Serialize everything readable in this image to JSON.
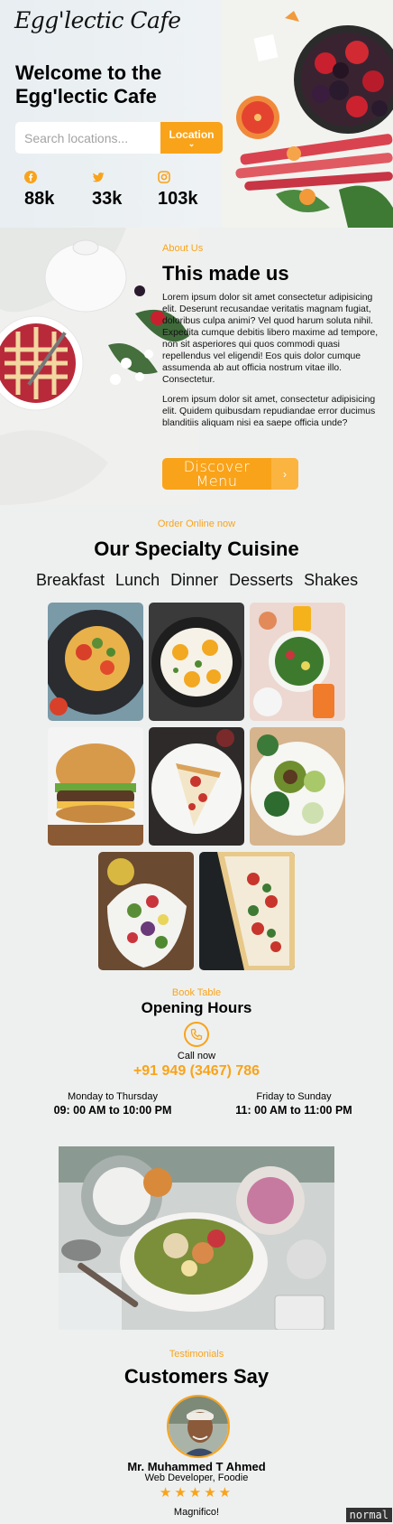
{
  "brand": {
    "logo": "Egg'lectic Cafe",
    "accent": "#f9a31a"
  },
  "hero": {
    "title": "Welcome to the Egg'lectic Cafe",
    "search_placeholder": "Search locations...",
    "location_button": "Location",
    "location_chevron": "⌄",
    "stats": [
      {
        "icon": "facebook-icon",
        "value": "88k"
      },
      {
        "icon": "twitter-icon",
        "value": "33k"
      },
      {
        "icon": "instagram-icon",
        "value": "103k"
      }
    ]
  },
  "about": {
    "label": "About Us",
    "title": "This made us",
    "p1": "Lorem ipsum dolor sit amet consectetur adipisicing elit. Deserunt recusandae veritatis magnam fugiat, doloribus culpa animi? Vel quod harum soluta nihil. Expedita cumque debitis libero maxime ad tempore, non sit asperiores qui quos commodi quasi repellendus vel eligendi! Eos quis dolor cumque assumenda ab aut officia nostrum vitae illo. Consectetur.",
    "p2": "Lorem ipsum dolor sit amet, consectetur adipisicing elit. Quidem quibusdam repudiandae error ducimus blanditiis aliquam nisi ea saepe officia unde?",
    "button": "Discover Menu",
    "button_arrow": "›"
  },
  "cuisine": {
    "label": "Order Online now",
    "title": "Our Specialty Cuisine",
    "tabs": [
      "Breakfast",
      "Lunch",
      "Dinner",
      "Desserts",
      "Shakes"
    ]
  },
  "hours": {
    "label": "Book Table",
    "title": "Opening Hours",
    "call_label": "Call now",
    "phone": "+91 949 (3467) 786",
    "weekday_label": "Monday to Thursday",
    "weekday_time": "09: 00 AM to 10:00 PM",
    "weekend_label": "Friday to Sunday",
    "weekend_time": "11: 00 AM to 11:00 PM"
  },
  "testimonials": {
    "label": "Testimonials",
    "title": "Customers Say",
    "name": "Mr. Muhammed T Ahmed",
    "role": "Web Developer, Foodie",
    "stars": "★★★★★",
    "rating": 5,
    "quote": "Magnifico!"
  },
  "editor_mode": "normal"
}
